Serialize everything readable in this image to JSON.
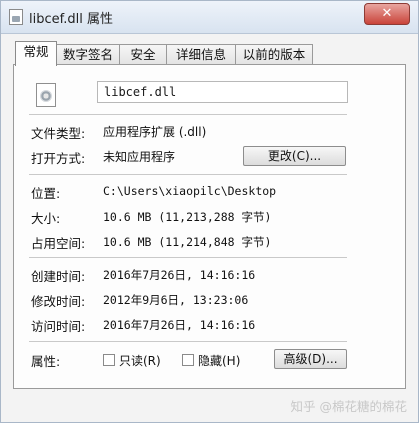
{
  "window": {
    "title": "libcef.dll 属性",
    "close_label": "✕"
  },
  "tabs": [
    {
      "label": "常规"
    },
    {
      "label": "数字签名"
    },
    {
      "label": "安全"
    },
    {
      "label": "详细信息"
    },
    {
      "label": "以前的版本"
    }
  ],
  "file": {
    "name": "libcef.dll"
  },
  "type_section": {
    "type_label": "文件类型:",
    "type_value": "应用程序扩展 (.dll)",
    "opens_label": "打开方式:",
    "opens_value": "未知应用程序",
    "change_button": "更改(C)..."
  },
  "location_section": {
    "location_label": "位置:",
    "location_value": "C:\\Users\\xiaopilc\\Desktop",
    "size_label": "大小:",
    "size_value": "10.6 MB (11,213,288 字节)",
    "disk_label": "占用空间:",
    "disk_value": "10.6 MB (11,214,848 字节)"
  },
  "dates_section": {
    "created_label": "创建时间:",
    "created_value": "2016年7月26日, 14:16:16",
    "modified_label": "修改时间:",
    "modified_value": "2012年9月6日, 13:23:06",
    "accessed_label": "访问时间:",
    "accessed_value": "2016年7月26日, 14:16:16"
  },
  "attributes": {
    "label": "属性:",
    "readonly_label": "只读(R)",
    "hidden_label": "隐藏(H)",
    "advanced_button": "高级(D)..."
  },
  "watermark": "知乎 @棉花糖的棉花"
}
